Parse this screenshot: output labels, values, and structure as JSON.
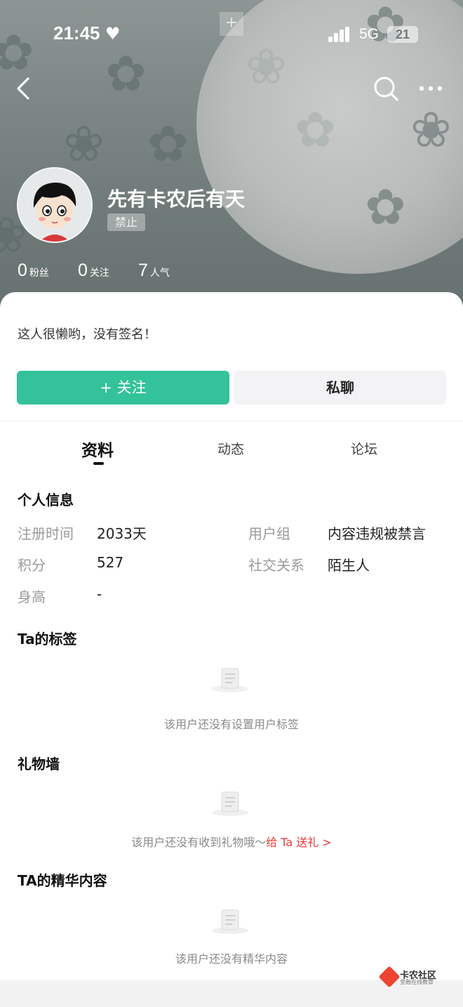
{
  "status_bar": {
    "time": "21:45",
    "network": "5G",
    "battery": "21"
  },
  "profile": {
    "nickname": "先有卡农后有天",
    "badge": "禁止",
    "stats": [
      {
        "num": "0",
        "label": "粉丝"
      },
      {
        "num": "0",
        "label": "关注"
      },
      {
        "num": "7",
        "label": "人气"
      }
    ],
    "signature": "这人很懒哟，没有签名！"
  },
  "actions": {
    "follow": "+ 关注",
    "chat": "私聊"
  },
  "tabs": [
    {
      "label": "资料",
      "active": true
    },
    {
      "label": "动态",
      "active": false
    },
    {
      "label": "论坛",
      "active": false
    }
  ],
  "personal_info": {
    "title": "个人信息",
    "rows": [
      {
        "label": "注册时间",
        "value": "2033天"
      },
      {
        "label": "用户组",
        "value": "内容违规被禁言"
      },
      {
        "label": "积分",
        "value": "527"
      },
      {
        "label": "社交关系",
        "value": "陌生人"
      },
      {
        "label": "身高",
        "value": "-"
      }
    ]
  },
  "tags": {
    "title": "Ta的标签",
    "empty_text": "该用户还没有设置用户标签"
  },
  "gifts": {
    "title": "礼物墙",
    "empty_text": "该用户还没有收到礼物哦～",
    "link_text": "给 Ta 送礼 >"
  },
  "featured": {
    "title": "TA的精华内容",
    "empty_text": "该用户还没有精华内容"
  },
  "watermark": {
    "name": "卡农社区",
    "sub": "金融在线教育"
  },
  "colors": {
    "accent": "#33c29a",
    "link_red": "#e23b3b",
    "header_bg": "#7c8684"
  }
}
